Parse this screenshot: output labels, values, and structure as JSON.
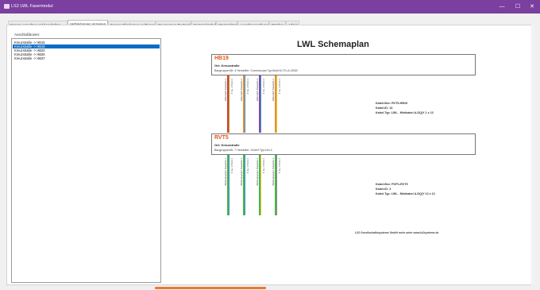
{
  "window": {
    "title": "LS2 LWL Fasermodul",
    "controls": {
      "minimize": "—",
      "maximize": "☐",
      "close": "✕"
    }
  },
  "tabs": [
    {
      "label": "Fasern verwalten und beschalten"
    },
    {
      "label": "Verbindungen anzeigen",
      "active": true
    },
    {
      "label": "Faserverbindungen quittieren"
    },
    {
      "label": "Baugruppen Bestand"
    },
    {
      "label": "Bestand Kabel"
    },
    {
      "label": "Stammdaten"
    },
    {
      "label": "Leerohrverwaltung"
    },
    {
      "label": "Patchen"
    },
    {
      "label": "Admin"
    }
  ],
  "left_panel": {
    "label": "Anschlußboxen:",
    "items": [
      {
        "text": "Kreuzstraße -> HB15",
        "selected": false
      },
      {
        "text": "Kreuzstraße -> HB19",
        "selected": true
      },
      {
        "text": "Kreuzstraße -> HB24",
        "selected": false
      },
      {
        "text": "Kreuzstraße -> HB26",
        "selected": false
      },
      {
        "text": "Kreuzstraße -> HB37",
        "selected": false
      }
    ]
  },
  "schematic": {
    "title": "LWL Schemaplan",
    "box1": {
      "name": "HB19",
      "ort": "Ort: Kreuzstraße",
      "detail": "BaugruppenID: 4 Hersteller: Commscope Typ:Bodi M-TG-A-CB30"
    },
    "cable1": {
      "bez": "Kabel-Bez: RVT5-HB19",
      "id": "Kabel-ID: 13",
      "typ": "Kabel-Typ: LWL - Minikabel A-DQ(Y 1 x 12"
    },
    "wires1": [
      {
        "color": "#e23a2c",
        "label_a": "Ebersdorf Kassette 1",
        "label_b": "F 1a. 1.5 km 1"
      },
      {
        "color": "#e8902e",
        "label_a": "Ebersdorf Kassette 1",
        "label_b": "F 1a. 1.5 km 1"
      },
      {
        "color": "#7c4fa6",
        "label_a": "Ebersdorf Kassette 1",
        "label_b": "F 1a. 1.5 km 1"
      },
      {
        "color": "#e8902e",
        "label_a": "Ebersdorf Kassette 1",
        "label_b": "F 1a. 1.5 km 1"
      }
    ],
    "wires1_accent": [
      "#9aa03c",
      "#3f8fd1",
      "#3f8fd1",
      "#e7c22a"
    ],
    "box2": {
      "name": "RVT5",
      "ort": "Ort: Kreuzstraße",
      "detail": "BaugruppenID: 7 Hersteller: Scherf Typ:Lfm 4"
    },
    "cable2": {
      "bez": "Kabel-Bez: POP1-RVT5",
      "id": "Kabel-ID: 3",
      "typ": "Kabel-Typ: LWL - Minikabel A-DQ(Y 12 x 12"
    },
    "wires2": [
      {
        "color": "#49b649",
        "label_a": "Weitergruppen Kassette 1",
        "label_b": "F 1a. 1.5 km 1"
      },
      {
        "color": "#49b649",
        "label_a": "Weitergruppen Kassette 1",
        "label_b": "F 1a. 1.5 km 1"
      },
      {
        "color": "#49b649",
        "label_a": "Weitergruppen Kassette 1",
        "label_b": "F 1a. 1.5 km 1"
      },
      {
        "color": "#49b649",
        "label_a": "Weitergruppen Kassette 1",
        "label_b": "F 1a. 1.5 km 1"
      }
    ],
    "wires2_accent": [
      "#3f8fd1",
      "#3f8fd1",
      "#e7c22a",
      "#8a8a8a"
    ],
    "footer": "LS2 Gesellschaftssysteme GmbH mehr unter www.ls2systeme.de"
  }
}
